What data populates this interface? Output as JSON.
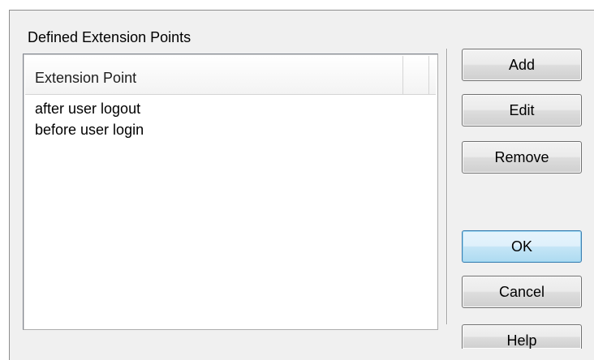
{
  "group": {
    "label": "Defined Extension Points"
  },
  "listview": {
    "columns": [
      "Extension Point",
      ""
    ],
    "rows": [
      "after user logout",
      "before user login"
    ]
  },
  "buttons": {
    "add": "Add",
    "edit": "Edit",
    "remove": "Remove",
    "ok": "OK",
    "cancel": "Cancel",
    "help": "Help"
  },
  "colors": {
    "dialog_background": "#f0f0f0",
    "default_button_accent": "#3c7fb1"
  }
}
